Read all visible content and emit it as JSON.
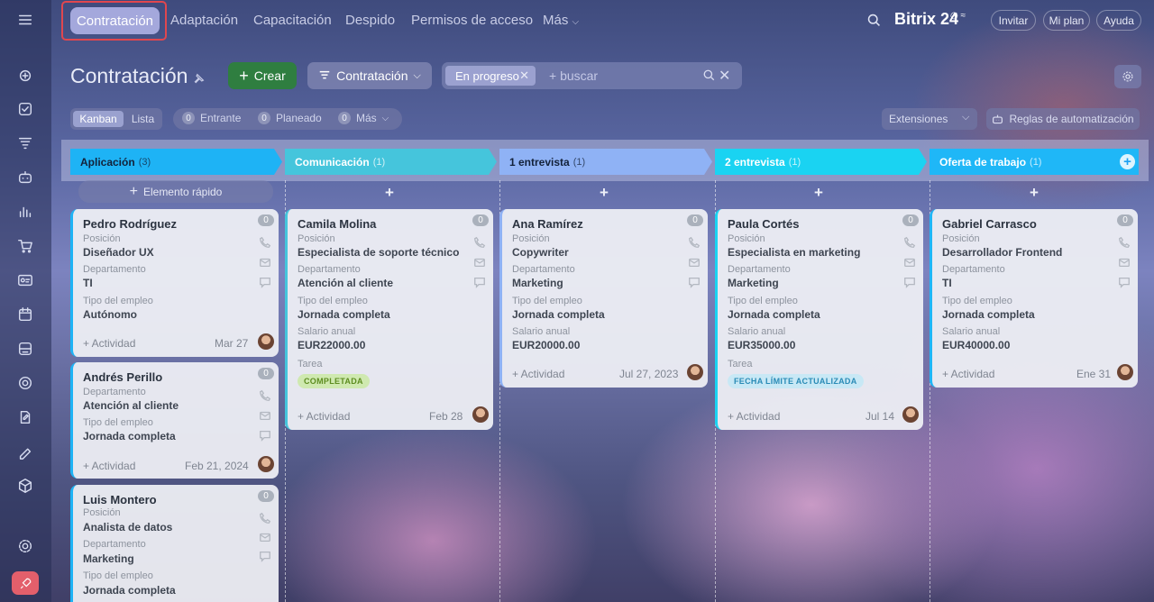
{
  "topnav": {
    "tabs": [
      "Contratación",
      "Adaptación",
      "Capacitación",
      "Despido",
      "Permisos de acceso",
      "Más"
    ],
    "brand": "Bitrix 24",
    "invite": "Invitar",
    "my_plan": "Mi plan",
    "help": "Ayuda"
  },
  "toolbar": {
    "title": "Contratación",
    "create": "Crear",
    "pipeline": "Contratación",
    "filter_chip": "En progreso",
    "search_placeholder": "+ buscar"
  },
  "view": {
    "kanban": "Kanban",
    "list": "Lista",
    "incoming_count": "0",
    "incoming": "Entrante",
    "planned_count": "0",
    "planned": "Planeado",
    "more_count": "0",
    "more": "Más",
    "extensions": "Extensiones",
    "automation": "Reglas de automatización"
  },
  "quick_add": "Elemento rápido",
  "stages": [
    {
      "name": "Aplicación",
      "count": "(3)",
      "color": "#1eb3f5"
    },
    {
      "name": "Comunicación",
      "count": "(1)",
      "color": "#45c5dc"
    },
    {
      "name": "1 entrevista",
      "count": "(1)",
      "color": "#8fb2f5"
    },
    {
      "name": "2 entrevista",
      "count": "(1)",
      "color": "#1ad3f2"
    },
    {
      "name": "Oferta de trabajo",
      "count": "(1)",
      "color": "#1fb7f7"
    }
  ],
  "cards": {
    "c1": {
      "name": "Pedro Rodríguez",
      "l1": "Posición",
      "v1": "Diseñador UX",
      "l2": "Departamento",
      "v2": "TI",
      "l3": "Tipo del empleo",
      "v3": "Autónomo",
      "activity": "+ Actividad",
      "date": "Mar 27",
      "badge": "0"
    },
    "c2": {
      "name": "Andrés Perillo",
      "l1": "Departamento",
      "v1": "Atención al cliente",
      "l2": "Tipo del empleo",
      "v2": "Jornada completa",
      "activity": "+ Actividad",
      "date": "Feb 21, 2024",
      "badge": "0"
    },
    "c3": {
      "name": "Luis Montero",
      "l1": "Posición",
      "v1": "Analista de datos",
      "l2": "Departamento",
      "v2": "Marketing",
      "l3": "Tipo del empleo",
      "v3": "Jornada completa",
      "badge": "0"
    },
    "c4": {
      "name": "Camila Molina",
      "l1": "Posición",
      "v1": "Especialista de soporte técnico",
      "l2": "Departamento",
      "v2": "Atención al cliente",
      "l3": "Tipo del empleo",
      "v3": "Jornada completa",
      "l4": "Salario anual",
      "v4": "EUR22000.00",
      "l5": "Tarea",
      "tag": "COMPLETADA",
      "activity": "+ Actividad",
      "date": "Feb 28",
      "badge": "0"
    },
    "c5": {
      "name": "Ana Ramírez",
      "l1": "Posición",
      "v1": "Copywriter",
      "l2": "Departamento",
      "v2": "Marketing",
      "l3": "Tipo del empleo",
      "v3": "Jornada completa",
      "l4": "Salario anual",
      "v4": "EUR20000.00",
      "activity": "+ Actividad",
      "date": "Jul 27, 2023",
      "badge": "0"
    },
    "c6": {
      "name": "Paula Cortés",
      "l1": "Posición",
      "v1": "Especialista en marketing",
      "l2": "Departamento",
      "v2": "Marketing",
      "l3": "Tipo del empleo",
      "v3": "Jornada completa",
      "l4": "Salario anual",
      "v4": "EUR35000.00",
      "l5": "Tarea",
      "tag": "FECHA LÍMITE ACTUALIZADA",
      "activity": "+ Actividad",
      "date": "Jul 14",
      "badge": "0"
    },
    "c7": {
      "name": "Gabriel Carrasco",
      "l1": "Posición",
      "v1": "Desarrollador Frontend",
      "l2": "Departamento",
      "v2": "TI",
      "l3": "Tipo del empleo",
      "v3": "Jornada completa",
      "l4": "Salario anual",
      "v4": "EUR40000.00",
      "activity": "+ Actividad",
      "date": "Ene 31",
      "badge": "0"
    }
  }
}
